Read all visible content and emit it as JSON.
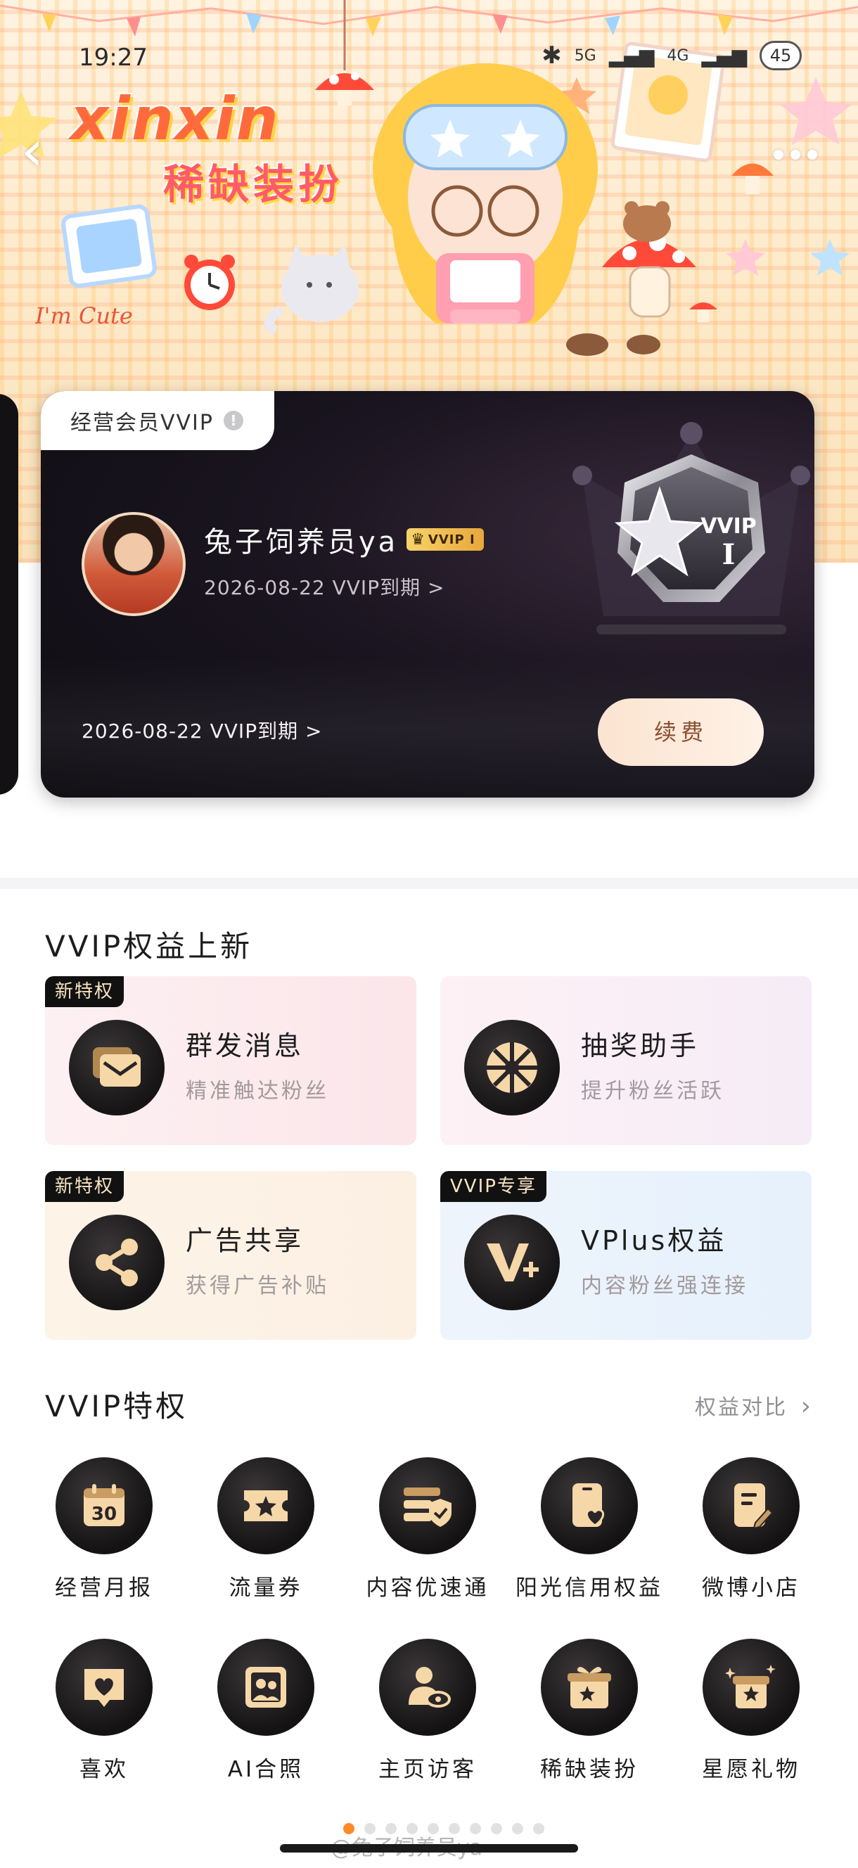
{
  "status_bar": {
    "time": "19:27",
    "signal_1": "5G",
    "signal_2": "4G",
    "battery": "45"
  },
  "banner": {
    "brand": "xinxin",
    "subtitle": "稀缺装扮",
    "cute_text": "I'm Cute"
  },
  "vip_card": {
    "tab_label": "经营会员VVIP",
    "username": "兔子饲养员ya",
    "badge": "VVIP I",
    "expire_top": "2026-08-22 VVIP到期 >",
    "expire_bottom": "2026-08-22 VVIP到期 >",
    "renew_label": "续费",
    "emblem_text": "VVIP",
    "emblem_level": "I"
  },
  "new_benefits": {
    "title": "VVIP权益上新",
    "items": [
      {
        "tag": "新特权",
        "title": "群发消息",
        "desc": "精准触达粉丝",
        "icon": "message-icon"
      },
      {
        "tag": "",
        "title": "抽奖助手",
        "desc": "提升粉丝活跃",
        "icon": "lottery-wheel-icon"
      },
      {
        "tag": "新特权",
        "title": "广告共享",
        "desc": "获得广告补贴",
        "icon": "share-icon"
      },
      {
        "tag": "VVIP专享",
        "title": "VPlus权益",
        "desc": "内容粉丝强连接",
        "icon": "vplus-icon"
      }
    ]
  },
  "privileges": {
    "title": "VVIP特权",
    "compare_link": "权益对比",
    "items": [
      {
        "label": "经营月报",
        "icon": "calendar-icon",
        "icon_text": "30"
      },
      {
        "label": "流量券",
        "icon": "ticket-icon"
      },
      {
        "label": "内容优速通",
        "icon": "shield-list-icon"
      },
      {
        "label": "阳光信用权益",
        "icon": "credit-heart-icon"
      },
      {
        "label": "微博小店",
        "icon": "shop-note-icon"
      },
      {
        "label": "喜欢",
        "icon": "heart-icon"
      },
      {
        "label": "AI合照",
        "icon": "photo-icon"
      },
      {
        "label": "主页访客",
        "icon": "visitor-icon"
      },
      {
        "label": "稀缺装扮",
        "icon": "gift-box-icon"
      },
      {
        "label": "星愿礼物",
        "icon": "star-gift-icon"
      }
    ]
  },
  "watermark": "@兔子饲养员ya",
  "colors": {
    "accent": "#f6d7a8",
    "dark": "#141213",
    "orange": "#ff8a2b"
  }
}
